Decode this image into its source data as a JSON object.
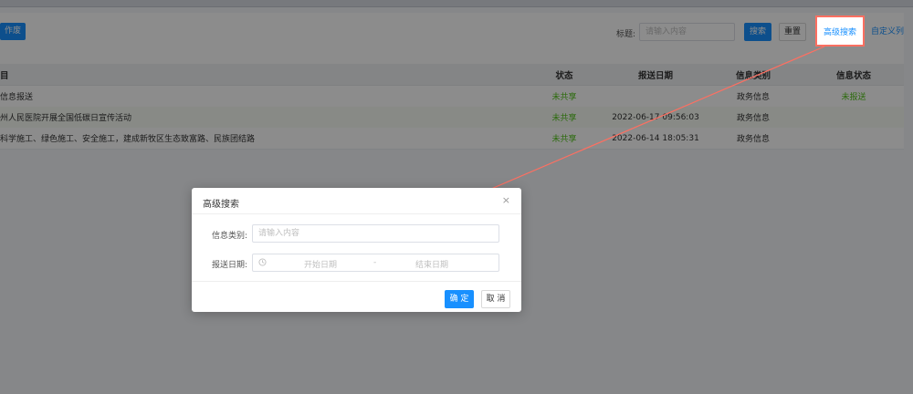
{
  "toolbar": {
    "left_button_label": "作废",
    "title_label": "标题:",
    "title_placeholder": "请输入内容",
    "search_label": "搜索",
    "reset_label": "重置",
    "advanced_search_label": "高级搜索",
    "custom_columns_label": "自定义列"
  },
  "table": {
    "headers": [
      "目",
      "状态",
      "报送日期",
      "信息类别",
      "信息状态"
    ],
    "rows": [
      {
        "title": "信息报送",
        "status": "未共享",
        "date": "",
        "category": "政务信息",
        "info_status": "未报送"
      },
      {
        "title": "州人民医院开展全国低碳日宣传活动",
        "status": "未共享",
        "date": "2022-06-17 09:56:03",
        "category": "政务信息",
        "info_status": ""
      },
      {
        "title": "科学施工、绿色施工、安全施工，建成新牧区生态致富路、民族团结路",
        "status": "未共享",
        "date": "2022-06-14 18:05:31",
        "category": "政务信息",
        "info_status": ""
      }
    ]
  },
  "modal": {
    "title": "高级搜索",
    "close_symbol": "×",
    "category_label": "信息类别:",
    "category_placeholder": "请输入内容",
    "date_label": "报送日期:",
    "start_placeholder": "开始日期",
    "range_separator": "-",
    "end_placeholder": "结束日期",
    "confirm_label": "确 定",
    "cancel_label": "取 消"
  },
  "colors": {
    "primary": "#1890ff",
    "success": "#52c41a",
    "annotation": "#ff6f61"
  }
}
